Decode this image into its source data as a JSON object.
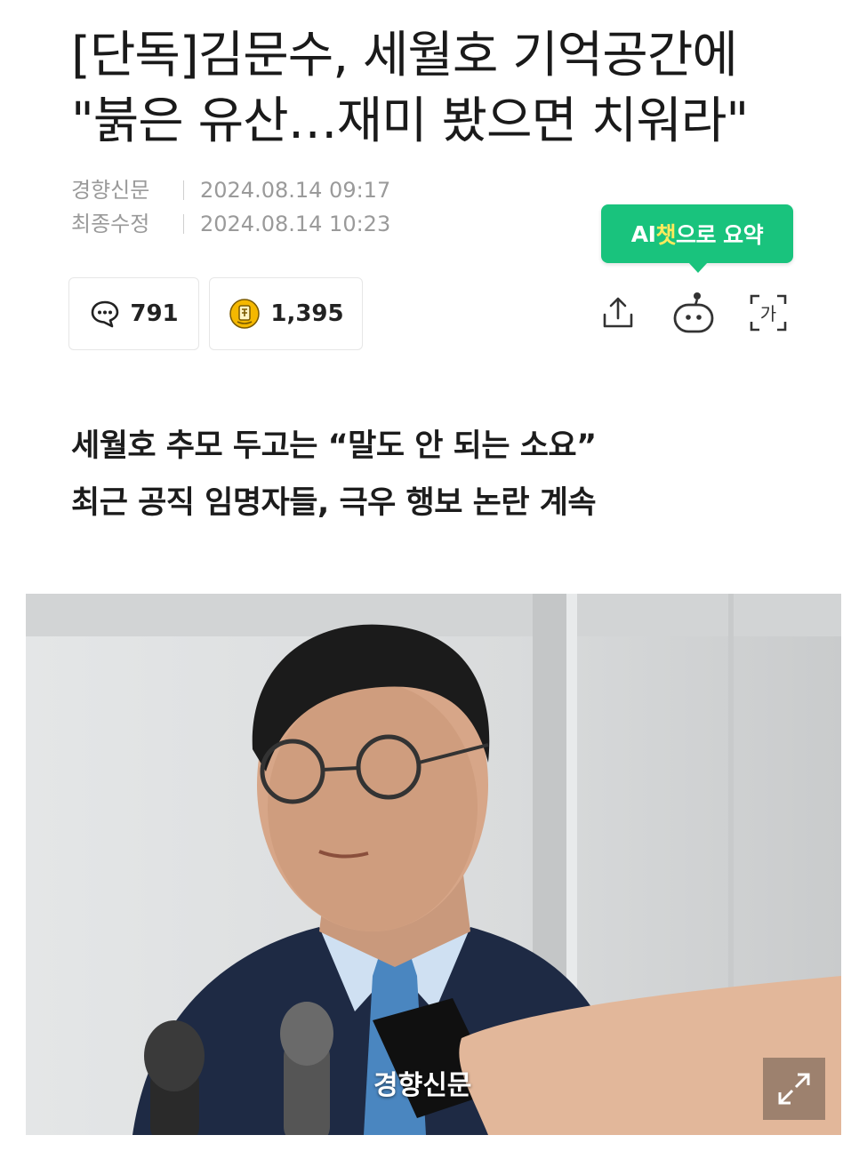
{
  "article": {
    "headline_line1": "[단독]김문수, 세월호 기억공간에",
    "headline_line2": "\"붉은 유산…재미 봤으면 치워라\"",
    "publisher": "경향신문",
    "published_label": "경향신문",
    "published_time": "2024.08.14 09:17",
    "updated_label": "최종수정",
    "updated_time": "2024.08.14 10:23",
    "subhead_line1": "세월호 추모 두고는 “말도 안 되는 소요”",
    "subhead_line2": "최근 공직 임명자들, 극우 행보 논란 계속",
    "photo_caption": "경향신문"
  },
  "ai_summary": {
    "label_prefix": "AI",
    "label_accent": "챗",
    "label_suffix": "으로 요약"
  },
  "stats": {
    "comments": "791",
    "reactions": "1,395"
  },
  "toolbar": {
    "share_icon": "share-icon",
    "bot_icon": "chatbot-icon",
    "font_icon": "font-size-icon",
    "font_glyph": "가"
  },
  "colors": {
    "accent": "#19c37d",
    "accent_highlight": "#ffea5c",
    "reaction_badge": "#f5b800"
  }
}
